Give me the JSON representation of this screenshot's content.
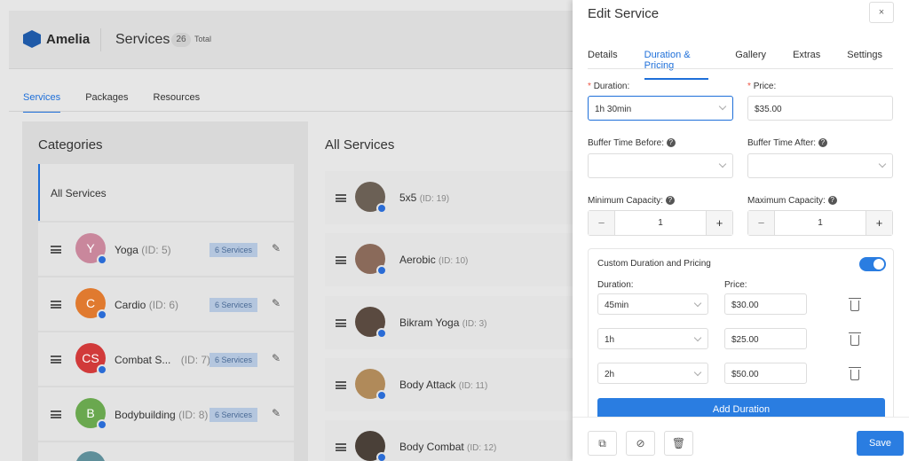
{
  "app": {
    "logo": "Amelia",
    "title": "Services",
    "count": "26",
    "count_suffix": "Total"
  },
  "main_tabs": [
    {
      "label": "Services"
    },
    {
      "label": "Packages"
    },
    {
      "label": "Resources"
    }
  ],
  "categories": {
    "title": "Categories",
    "all_label": "All Services",
    "items": [
      {
        "initial": "Y",
        "name": "Yoga",
        "id": "(ID: 5)",
        "badge": "6 Services",
        "color": "#c9879c"
      },
      {
        "initial": "C",
        "name": "Cardio",
        "id": "(ID: 6)",
        "badge": "6 Services",
        "color": "#e07a2f"
      },
      {
        "initial": "CS",
        "name": "Combat S...",
        "id": "(ID: 7)",
        "badge": "6 Services",
        "color": "#d13a3a"
      },
      {
        "initial": "B",
        "name": "Bodybuilding",
        "id": "(ID: 8)",
        "badge": "6 Services",
        "color": "#6aa84f"
      }
    ]
  },
  "services": {
    "title": "All Services",
    "items": [
      {
        "name": "5x5",
        "id": "(ID: 19)"
      },
      {
        "name": "Aerobic",
        "id": "(ID: 10)"
      },
      {
        "name": "Bikram Yoga",
        "id": "(ID: 3)"
      },
      {
        "name": "Body Attack",
        "id": "(ID: 11)"
      },
      {
        "name": "Body Combat",
        "id": "(ID: 12)"
      }
    ]
  },
  "drawer": {
    "title": "Edit Service",
    "close": "×",
    "tabs": [
      {
        "label": "Details"
      },
      {
        "label": "Duration & Pricing"
      },
      {
        "label": "Gallery"
      },
      {
        "label": "Extras"
      },
      {
        "label": "Settings"
      }
    ],
    "duration_label": "Duration:",
    "duration_value": "1h  30min",
    "price_label": "Price:",
    "price_value": "$35.00",
    "buffer_before_label": "Buffer Time Before:",
    "buffer_after_label": "Buffer Time After:",
    "min_capacity_label": "Minimum Capacity:",
    "max_capacity_label": "Maximum Capacity:",
    "min_capacity": "1",
    "max_capacity": "1",
    "custom": {
      "title": "Custom Duration and Pricing",
      "duration_header": "Duration:",
      "price_header": "Price:",
      "rows": [
        {
          "duration": "45min",
          "price": "$30.00"
        },
        {
          "duration": "1h",
          "price": "$25.00"
        },
        {
          "duration": "2h",
          "price": "$50.00"
        }
      ],
      "add_label": "Add Duration"
    },
    "save_label": "Save",
    "req_mark": "*",
    "help_mark": "?",
    "minus": "−",
    "plus": "+"
  }
}
